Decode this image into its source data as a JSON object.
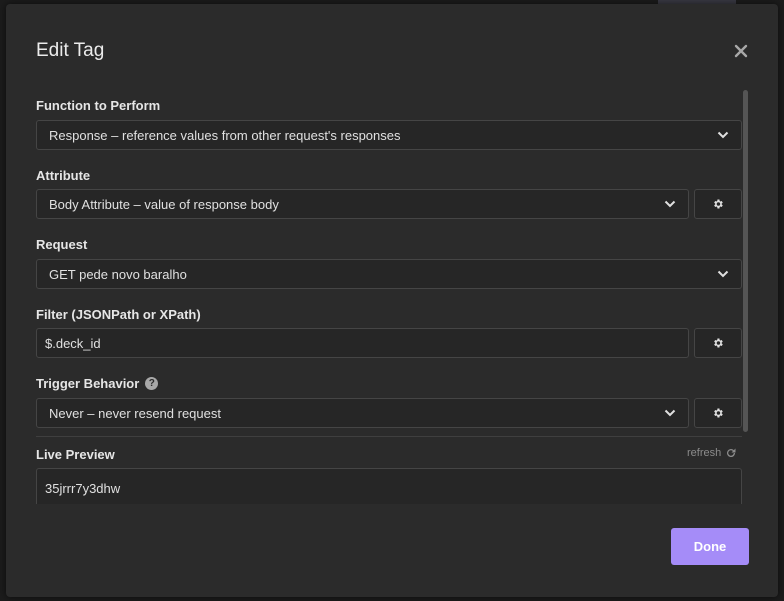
{
  "dialog": {
    "title": "Edit Tag",
    "close_symbol": "✕"
  },
  "function_field": {
    "label": "Function to Perform",
    "value": "Response – reference values from other request's responses"
  },
  "attribute_field": {
    "label": "Attribute",
    "value": "Body Attribute – value of response body"
  },
  "request_field": {
    "label": "Request",
    "value": "GET pede novo baralho"
  },
  "filter_field": {
    "label": "Filter (JSONPath or XPath)",
    "value": "$.deck_id"
  },
  "trigger_field": {
    "label": "Trigger Behavior",
    "help_symbol": "?",
    "value": "Never – never resend request"
  },
  "live_preview": {
    "label": "Live Preview",
    "refresh_label": "refresh",
    "value": "35jrrr7y3dhw"
  },
  "footer": {
    "done_label": "Done"
  },
  "colors": {
    "accent": "#a58cf8",
    "modal_bg": "#2b2b2b",
    "field_bg": "#262626",
    "border": "#454545"
  },
  "icons": {
    "close": "close-icon",
    "chevron": "chevron-down-icon",
    "gear": "gear-icon",
    "help": "help-icon",
    "refresh": "refresh-icon"
  }
}
